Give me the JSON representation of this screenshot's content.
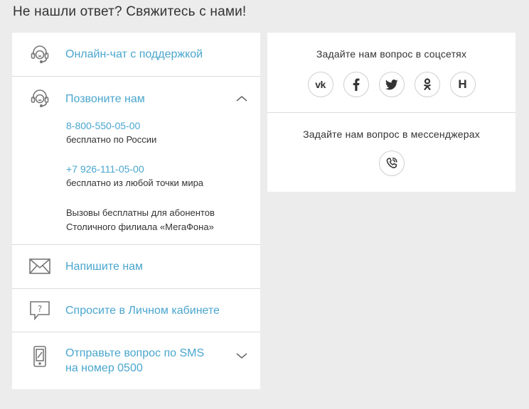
{
  "page_title": "Не нашли ответ? Свяжитесь с нами!",
  "contacts": {
    "chat": {
      "label": "Онлайн-чат с поддержкой"
    },
    "call": {
      "label": "Позвоните нам",
      "phone1": "8-800-550-05-00",
      "phone1_note": "бесплатно по России",
      "phone2": "+7 926-111-05-00",
      "phone2_note": "бесплатно из любой точки мира",
      "note_line1": "Вызовы бесплатны для абонентов",
      "note_line2": "Столичного филиала «МегаФона»"
    },
    "mail": {
      "label": "Напишите нам"
    },
    "cabinet": {
      "label": "Спросите в Личном кабинете"
    },
    "sms": {
      "label_line1": "Отправьте вопрос по SMS",
      "label_line2": "на номер 0500"
    }
  },
  "social": {
    "title": "Задайте нам вопрос в соцсетях",
    "icons": [
      "vk-icon",
      "facebook-icon",
      "twitter-icon",
      "odnoklassniki-icon",
      "habr-icon"
    ],
    "vk_text": "vk",
    "habr_text": "H"
  },
  "messengers": {
    "title": "Задайте нам вопрос в мессенджерах",
    "icons": [
      "viber-icon"
    ]
  },
  "colors": {
    "link": "#4aa6ce",
    "text": "#333333",
    "background": "#ececec",
    "card": "#ffffff"
  }
}
